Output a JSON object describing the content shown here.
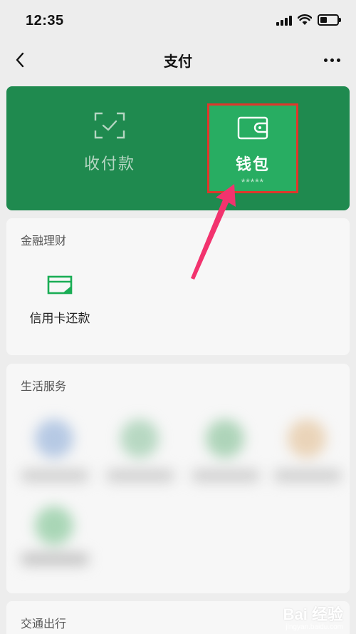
{
  "status_bar": {
    "time": "12:35"
  },
  "nav": {
    "title": "支付"
  },
  "pay_card": {
    "collect_label": "收付款",
    "wallet_label": "钱包",
    "wallet_balance": "*****"
  },
  "finance": {
    "title": "金融理财",
    "items": [
      {
        "label": "信用卡还款",
        "icon": "credit-card-repay-icon"
      }
    ]
  },
  "life": {
    "title": "生活服务"
  },
  "traffic": {
    "title": "交通出行"
  },
  "watermark": {
    "brand": "Bai 经验",
    "url": "jingyan.baidu.com"
  },
  "colors": {
    "card_green": "#1f8a4f",
    "wallet_green": "#28ad62",
    "highlight_red": "#e0362b",
    "arrow_pink": "#f2336e"
  }
}
